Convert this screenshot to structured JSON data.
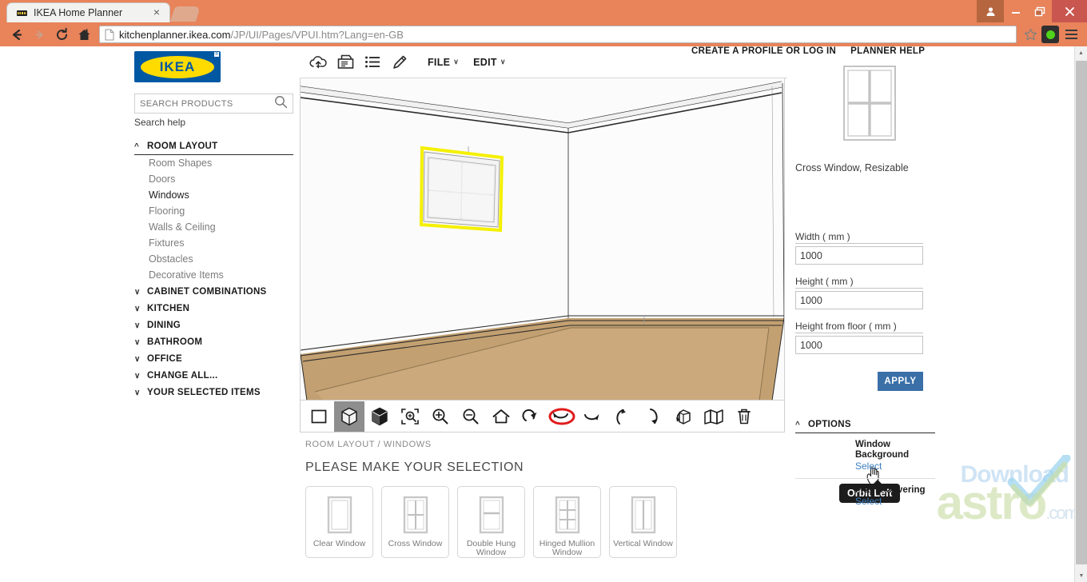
{
  "browser": {
    "tab_title": "IKEA Home Planner",
    "tab_close": "×",
    "url_strong": "kitchenplanner.ikea.com",
    "url_dim": "/JP/UI/Pages/VPUI.htm?Lang=en-GB",
    "back_icon": "back-arrow-icon",
    "forward_icon": "forward-arrow-icon",
    "reload_icon": "reload-icon",
    "home_icon": "home-icon",
    "minimize": "–",
    "maximize": "❐",
    "close": "✕"
  },
  "header": {
    "create_profile": "CREATE A PROFILE OR LOG IN",
    "planner_help": "PLANNER HELP"
  },
  "sidebar": {
    "logo_text": "IKEA",
    "logo_reg": "®",
    "search_placeholder": "SEARCH PRODUCTS",
    "search_value": "",
    "search_help": "Search help",
    "groups": [
      {
        "label": "ROOM LAYOUT",
        "open": true,
        "children": [
          "Room Shapes",
          "Doors",
          "Windows",
          "Flooring",
          "Walls & Ceiling",
          "Fixtures",
          "Obstacles",
          "Decorative Items"
        ]
      },
      {
        "label": "CABINET COMBINATIONS",
        "open": false,
        "children": []
      },
      {
        "label": "KITCHEN",
        "open": false,
        "children": []
      },
      {
        "label": "DINING",
        "open": false,
        "children": []
      },
      {
        "label": "BATHROOM",
        "open": false,
        "children": []
      },
      {
        "label": "OFFICE",
        "open": false,
        "children": []
      },
      {
        "label": "CHANGE ALL...",
        "open": false,
        "children": []
      },
      {
        "label": "YOUR SELECTED ITEMS",
        "open": false,
        "children": []
      }
    ],
    "active_child": "Windows"
  },
  "toolbar": {
    "icons": [
      "cloud-upload-icon",
      "print-icon",
      "list-icon",
      "pencil-icon"
    ],
    "file_label": "FILE",
    "edit_label": "EDIT",
    "caret": "⌄"
  },
  "viewport_toolbar": {
    "buttons": [
      {
        "name": "view-2d-icon",
        "label": "2D View",
        "selected": false
      },
      {
        "name": "view-3d-wireframe-icon",
        "label": "3D Wireframe",
        "selected": true
      },
      {
        "name": "view-3d-solid-icon",
        "label": "3D Solid",
        "selected": false
      },
      {
        "name": "zoom-to-fit-icon",
        "label": "Zoom to Fit",
        "selected": false
      },
      {
        "name": "zoom-in-icon",
        "label": "Zoom In",
        "selected": false
      },
      {
        "name": "zoom-out-icon",
        "label": "Zoom Out",
        "selected": false
      },
      {
        "name": "home-view-icon",
        "label": "Home View",
        "selected": false
      },
      {
        "name": "rotate-left-icon",
        "label": "Rotate Left",
        "selected": false
      },
      {
        "name": "orbit-left-icon",
        "label": "Orbit Left",
        "selected": false,
        "highlighted": true
      },
      {
        "name": "orbit-right-icon",
        "label": "Orbit Right",
        "selected": false
      },
      {
        "name": "tilt-up-icon",
        "label": "Tilt Up",
        "selected": false
      },
      {
        "name": "tilt-down-icon",
        "label": "Tilt Down",
        "selected": false
      },
      {
        "name": "walk-through-icon",
        "label": "Walk Through",
        "selected": false
      },
      {
        "name": "unfold-view-icon",
        "label": "Unfold View",
        "selected": false
      },
      {
        "name": "delete-icon",
        "label": "Delete",
        "selected": false
      }
    ],
    "tooltip": "Orbit Left"
  },
  "main": {
    "breadcrumb": "ROOM LAYOUT / WINDOWS",
    "section_title": "PLEASE MAKE YOUR SELECTION",
    "thumbnails": [
      {
        "label": "Clear Window",
        "type": "clear"
      },
      {
        "label": "Cross Window",
        "type": "cross"
      },
      {
        "label": "Double Hung Window",
        "type": "double-hung"
      },
      {
        "label": "Hinged Mullion Window",
        "type": "hinged-mullion"
      },
      {
        "label": "Vertical Window",
        "type": "vertical"
      }
    ]
  },
  "right_panel": {
    "product_name": "Cross Window, Resizable",
    "product_preview_icon": "cross-window-preview",
    "fields": [
      {
        "label": "Width ( mm )",
        "value": "1000",
        "name": "width-field"
      },
      {
        "label": "Height ( mm )",
        "value": "1000",
        "name": "height-field"
      },
      {
        "label": "Height from floor ( mm )",
        "value": "1000",
        "name": "height-from-floor-field"
      }
    ],
    "apply_label": "APPLY",
    "options_label": "OPTIONS",
    "options_caret": "⌃",
    "options": [
      {
        "title": "Window Background",
        "link": "Select"
      },
      {
        "title": "Frame Covering",
        "link": "Select"
      }
    ]
  },
  "watermark": {
    "line1": "Download",
    "line2": "astro",
    "line3": ".com"
  },
  "colors": {
    "browser_accent": "#e8835a",
    "ikea_blue": "#0058a3",
    "ikea_yellow": "#ffdb00",
    "apply_blue": "#3a6fa8",
    "link_blue": "#3b7fbf",
    "highlight_red": "#e01b1b",
    "selection_yellow": "#f4f000",
    "floor_brown": "#c09a6b"
  }
}
